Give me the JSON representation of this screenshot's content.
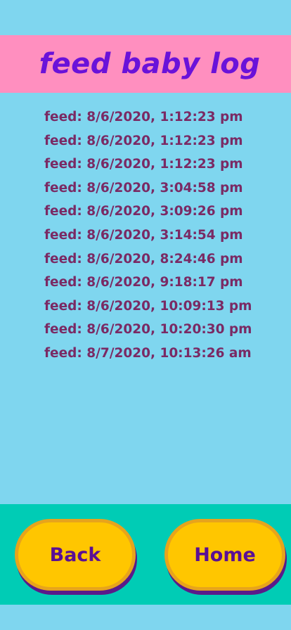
{
  "header": {
    "title": "feed baby log"
  },
  "log": {
    "entries": [
      "feed: 8/6/2020, 1:12:23 pm",
      "feed: 8/6/2020, 1:12:23 pm",
      "feed: 8/6/2020, 1:12:23 pm",
      "feed: 8/6/2020, 3:04:58 pm",
      "feed: 8/6/2020, 3:09:26 pm",
      "feed: 8/6/2020, 3:14:54 pm",
      "feed: 8/6/2020, 8:24:46 pm",
      "feed: 8/6/2020, 9:18:17 pm",
      "feed: 8/6/2020, 10:09:13 pm",
      "feed: 8/6/2020, 10:20:30 pm",
      "feed: 8/7/2020, 10:13:26 am"
    ]
  },
  "footer": {
    "back_label": "Back",
    "home_label": "Home"
  },
  "colors": {
    "background": "#7fd6ef",
    "header_bg": "#ff8fbf",
    "title": "#6a12d9",
    "entry_text": "#7a2a64",
    "footer_bg": "#00ccb5",
    "button_fill": "#ffc600",
    "button_border": "#e7a41c",
    "button_text": "#5a0f95",
    "button_shadow": "#5a1a8a"
  }
}
